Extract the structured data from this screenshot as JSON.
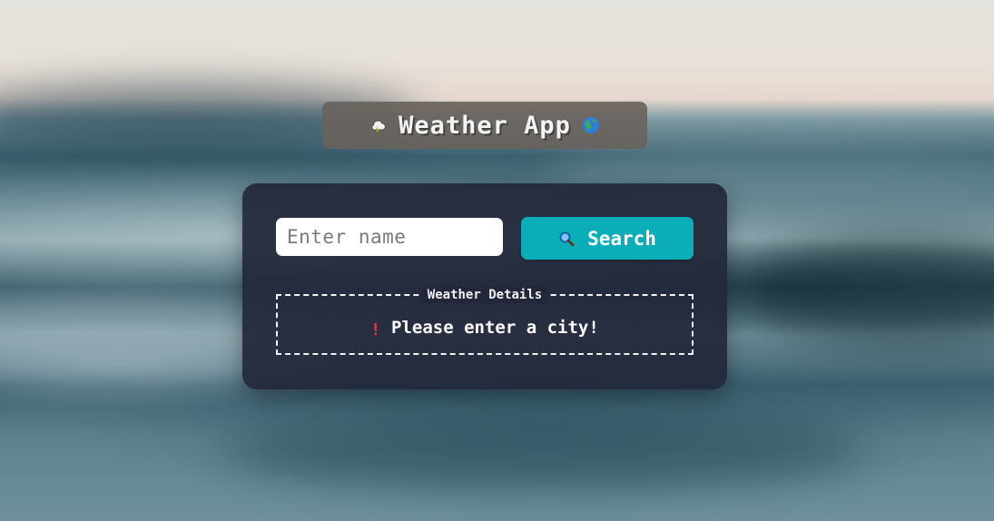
{
  "header": {
    "title": "Weather App",
    "left_icon": "cloud-icon",
    "right_icon": "globe-icon"
  },
  "search": {
    "placeholder": "Enter name",
    "value": "",
    "button_label": "Search",
    "button_icon": "magnifier-icon"
  },
  "details": {
    "legend": "Weather Details",
    "message": "Please enter a city!",
    "message_icon": "exclamation-icon"
  },
  "colors": {
    "card_background": "#22283a",
    "button_accent": "#0aaeb8",
    "title_badge": "#69625c",
    "alert": "#e23b3b",
    "text": "#ffffff"
  }
}
